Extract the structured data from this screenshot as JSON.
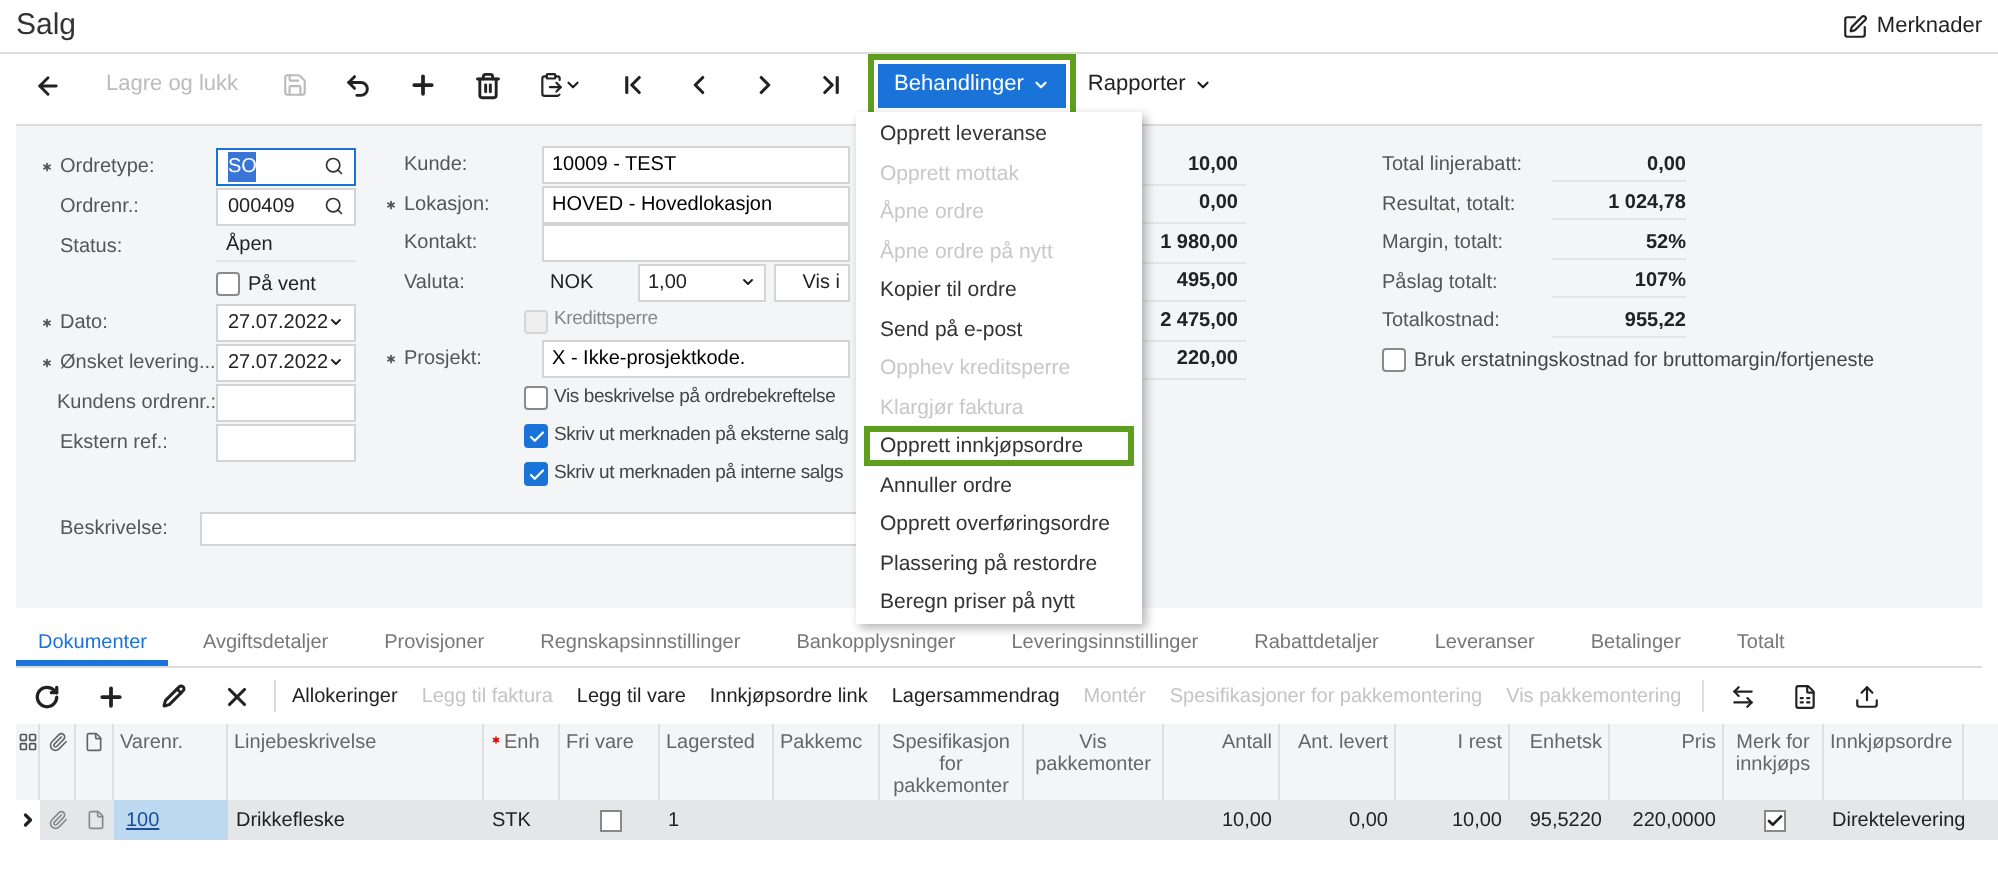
{
  "window": {
    "title": "Salg",
    "notes_button": "Merknader"
  },
  "toolbar": {
    "save_close": {
      "label": "Lagre og lukk",
      "disabled": true
    },
    "actions": {
      "label": "Behandlinger",
      "highlighted": true,
      "open": true
    },
    "reports": {
      "label": "Rapporter"
    }
  },
  "form_left": [
    {
      "kind": "lookup",
      "label": "Ordretype:",
      "required": true,
      "value": "SO",
      "focused": true
    },
    {
      "kind": "lookup",
      "label": "Ordrenr.:",
      "required": false,
      "value": "000409",
      "focused": false
    },
    {
      "kind": "static",
      "label": "Status:",
      "required": false,
      "value": "Åpen"
    },
    {
      "kind": "checkbox",
      "label": "På vent",
      "checked": false
    },
    {
      "kind": "select",
      "label": "Dato:",
      "required": true,
      "value": "27.07.2022"
    },
    {
      "kind": "select",
      "label": "Ønsket levering...",
      "required": true,
      "value": "27.07.2022"
    },
    {
      "kind": "text",
      "label": "Kundens ordrenr.:",
      "required": false
    },
    {
      "kind": "text",
      "label": "Ekstern ref.:",
      "required": false
    }
  ],
  "form_middle": [
    {
      "kind": "text",
      "label": "Kunde:",
      "required": false,
      "value": "10009 - TEST"
    },
    {
      "kind": "text",
      "label": "Lokasjon:",
      "required": true,
      "value": "HOVED - Hovedlokasjon"
    },
    {
      "kind": "text",
      "label": "Kontakt:",
      "required": false
    },
    {
      "kind": "currency",
      "label": "Valuta:",
      "required": false,
      "value": "NOK",
      "rate": "1,00",
      "button": "Vis i"
    },
    {
      "kind": "checkbox",
      "label": "Kredittsperre",
      "checked": false,
      "disabled": true
    },
    {
      "kind": "text",
      "label": "Prosjekt:",
      "required": true,
      "value": "X - Ikke-prosjektkode."
    },
    {
      "kind": "checkbox",
      "label": "Vis beskrivelse på ordrebekreftelse",
      "checked": false,
      "disabled": false
    },
    {
      "kind": "checkbox",
      "label": "Skriv ut merknaden på eksterne salg",
      "checked": true,
      "disabled": false
    },
    {
      "kind": "checkbox",
      "label": "Skriv ut merknaden på interne salgs",
      "checked": true,
      "disabled": false
    }
  ],
  "description": {
    "label": "Beskrivelse:"
  },
  "summary_values": [
    "10,00",
    "0,00",
    "1 980,00",
    "495,00",
    "2 475,00",
    "220,00"
  ],
  "totals": [
    {
      "label": "Total linjerabatt:",
      "value": "0,00"
    },
    {
      "label": "Resultat, totalt:",
      "value": "1 024,78"
    },
    {
      "label": "Margin, totalt:",
      "value": "52%"
    },
    {
      "label": "Påslag totalt:",
      "value": "107%"
    },
    {
      "label": "Totalkostnad:",
      "value": "955,22"
    }
  ],
  "totals_checkbox": {
    "label": "Bruk erstatningskostnad for bruttomargin/fortjeneste",
    "checked": false
  },
  "actions_menu": [
    {
      "label": "Opprett leveranse",
      "disabled": false,
      "highlighted": false
    },
    {
      "label": "Opprett mottak",
      "disabled": true,
      "highlighted": false
    },
    {
      "label": "Åpne ordre",
      "disabled": true,
      "highlighted": false
    },
    {
      "label": "Åpne ordre på nytt",
      "disabled": true,
      "highlighted": false
    },
    {
      "label": "Kopier til ordre",
      "disabled": false,
      "highlighted": false
    },
    {
      "label": "Send på e-post",
      "disabled": false,
      "highlighted": false
    },
    {
      "label": "Opphev kreditsperre",
      "disabled": true,
      "highlighted": false
    },
    {
      "label": "Klargjør faktura",
      "disabled": true,
      "highlighted": false
    },
    {
      "label": "Opprett innkjøpsordre",
      "disabled": false,
      "highlighted": true
    },
    {
      "label": "Annuller ordre",
      "disabled": false,
      "highlighted": false
    },
    {
      "label": "Opprett overføringsordre",
      "disabled": false,
      "highlighted": false
    },
    {
      "label": "Plassering på restordre",
      "disabled": false,
      "highlighted": false
    },
    {
      "label": "Beregn priser på nytt",
      "disabled": false,
      "highlighted": false
    }
  ],
  "tabs": [
    {
      "label": "Dokumenter",
      "selected": true
    },
    {
      "label": "Avgiftsdetaljer",
      "selected": false
    },
    {
      "label": "Provisjoner",
      "selected": false
    },
    {
      "label": "Regnskapsinnstillinger",
      "selected": false
    },
    {
      "label": "Bankopplysninger",
      "selected": false
    },
    {
      "label": "Leveringsinnstillinger",
      "selected": false
    },
    {
      "label": "Rabattdetaljer",
      "selected": false
    },
    {
      "label": "Leveranser",
      "selected": false
    },
    {
      "label": "Betalinger",
      "selected": false
    },
    {
      "label": "Totalt",
      "selected": false
    }
  ],
  "grid_toolbar": [
    {
      "label": "Allokeringer",
      "disabled": false
    },
    {
      "label": "Legg til faktura",
      "disabled": true
    },
    {
      "label": "Legg til vare",
      "disabled": false
    },
    {
      "label": "Innkjøpsordre link",
      "disabled": false
    },
    {
      "label": "Lagersammendrag",
      "disabled": false
    },
    {
      "label": "Montér",
      "disabled": true
    },
    {
      "label": "Spesifikasjoner for pakkemontering",
      "disabled": true
    },
    {
      "label": "Vis pakkemontering",
      "disabled": true
    }
  ],
  "table": {
    "columns": [
      {
        "label": "Varenr.",
        "required": false
      },
      {
        "label": "Linjebeskrivelse",
        "required": false
      },
      {
        "label": "Enh",
        "required": true
      },
      {
        "label": "Fri vare",
        "required": false
      },
      {
        "label": "Lagersted",
        "required": false
      },
      {
        "label": "Pakkemc",
        "required": false
      },
      {
        "label": "Spesifikasjon for pakkemonter",
        "required": false
      },
      {
        "label": "Vis pakkemonter",
        "required": false
      },
      {
        "label": "Antall",
        "required": false
      },
      {
        "label": "Ant. levert",
        "required": false
      },
      {
        "label": "I rest",
        "required": false
      },
      {
        "label": "Enhetsk",
        "required": false
      },
      {
        "label": "Pris",
        "required": false
      },
      {
        "label": "Merk for innkjøps",
        "required": false
      },
      {
        "label": "Innkjøpsordre",
        "required": false
      }
    ],
    "rows": [
      {
        "selected": true,
        "cells": [
          {
            "kind": "link",
            "value": "100",
            "selected": true
          },
          {
            "kind": "text",
            "value": "Drikkefleske"
          },
          {
            "kind": "text",
            "value": "STK"
          },
          {
            "kind": "checkbox",
            "checked": false
          },
          {
            "kind": "text",
            "value": "1"
          },
          {
            "kind": "empty"
          },
          {
            "kind": "empty"
          },
          {
            "kind": "empty"
          },
          {
            "kind": "text",
            "value": "10,00"
          },
          {
            "kind": "text",
            "value": "0,00"
          },
          {
            "kind": "text",
            "value": "10,00"
          },
          {
            "kind": "text",
            "value": "95,5220"
          },
          {
            "kind": "text",
            "value": "220,0000"
          },
          {
            "kind": "checkbox",
            "checked": true
          },
          {
            "kind": "text",
            "value": "Direktelevering"
          }
        ]
      }
    ]
  }
}
